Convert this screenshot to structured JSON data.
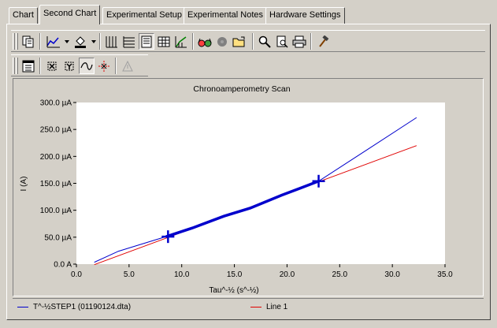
{
  "tabs": [
    {
      "label": "Chart",
      "active": false
    },
    {
      "label": "Second Chart",
      "active": true
    },
    {
      "label": "Experimental Setup",
      "active": false
    },
    {
      "label": "Experimental Notes",
      "active": false
    },
    {
      "label": "Hardware Settings",
      "active": false
    }
  ],
  "toolbar": {
    "row1_icons": [
      "copy-icon",
      "line-style-icon",
      "fill-color-icon",
      "vertical-grid-icon",
      "horizontal-grid-icon",
      "data-table-icon",
      "grid-table-icon",
      "axis-log-icon",
      "glasses-icon",
      "gear-cloud-icon",
      "folder-icon",
      "zoom-icon",
      "print-preview-icon",
      "print-icon",
      "hammer-icon"
    ],
    "row2_icons": [
      "properties-icon",
      "remove-x-icon",
      "remove-y-icon",
      "smooth-curve-icon",
      "point-select-icon",
      "warning-icon"
    ]
  },
  "colors": {
    "series1": "#0000cc",
    "series2": "#e00000",
    "plot_bg": "#ffffff"
  },
  "chart_data": {
    "type": "line",
    "title": "Chronoamperometry Scan",
    "xlabel": "Tau^-½ (s^-½)",
    "ylabel": "I (A)",
    "xlim": [
      0.0,
      35.0
    ],
    "ylim": [
      0.0,
      300.0
    ],
    "x_ticks": [
      "0.0",
      "5.0",
      "10.0",
      "15.0",
      "20.0",
      "25.0",
      "30.0",
      "35.0"
    ],
    "y_ticks": [
      "0.0 A",
      "50.0 µA",
      "100.0 µA",
      "150.0 µA",
      "200.0 µA",
      "250.0 µA",
      "300.0 µA"
    ],
    "series": [
      {
        "name": "T^-½STEP1 (01190124.dta)",
        "color": "#0000cc",
        "x": [
          1.7,
          4.0,
          6.0,
          8.5,
          11.0,
          14.0,
          16.5,
          19.5,
          23.0,
          27.5,
          32.3
        ],
        "y": [
          3.5,
          24,
          36,
          51,
          67,
          89,
          104,
          128,
          154,
          211,
          272
        ],
        "markers": [
          {
            "x": 8.7,
            "y": 51
          },
          {
            "x": 23.0,
            "y": 154
          }
        ]
      },
      {
        "name": "Line 1",
        "color": "#e00000",
        "x": [
          1.7,
          32.3
        ],
        "y": [
          -1,
          220
        ]
      }
    ],
    "legend_position": "bottom"
  }
}
